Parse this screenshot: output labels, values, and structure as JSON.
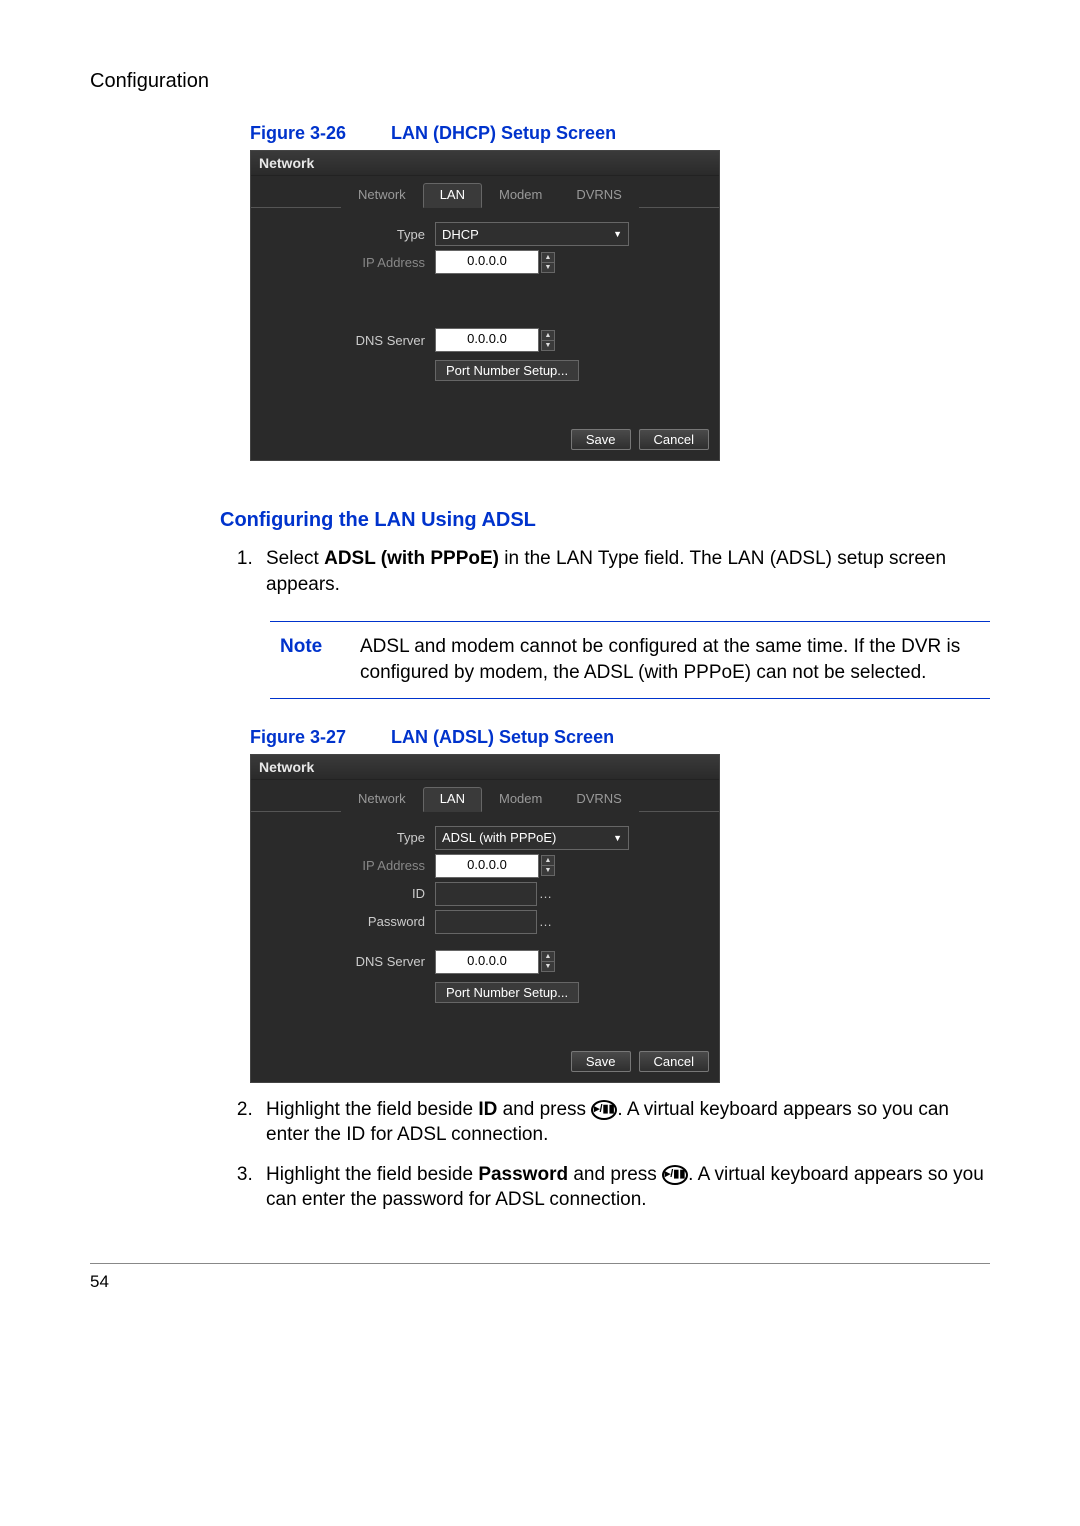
{
  "header": {
    "section": "Configuration"
  },
  "figure26": {
    "label": "Figure 3-26",
    "title": "LAN (DHCP) Setup Screen",
    "window_title": "Network",
    "tabs": [
      "Network",
      "LAN",
      "Modem",
      "DVRNS"
    ],
    "active_tab": "LAN",
    "type_label": "Type",
    "type_value": "DHCP",
    "ip_label": "IP Address",
    "ip_value": "0.0.0.0",
    "dns_label": "DNS Server",
    "dns_value": "0.0.0.0",
    "port_btn": "Port Number Setup...",
    "save": "Save",
    "cancel": "Cancel"
  },
  "subheading": "Configuring the LAN Using ADSL",
  "step1": {
    "pre": "Select ",
    "bold": "ADSL (with PPPoE)",
    "post": " in the LAN Type field. The LAN (ADSL) setup screen appears."
  },
  "note": {
    "label": "Note",
    "text": "ADSL and modem cannot be configured at the same time. If the DVR is configured by modem, the ADSL (with PPPoE) can not be selected."
  },
  "figure27": {
    "label": "Figure 3-27",
    "title": "LAN (ADSL) Setup Screen",
    "window_title": "Network",
    "tabs": [
      "Network",
      "LAN",
      "Modem",
      "DVRNS"
    ],
    "active_tab": "LAN",
    "type_label": "Type",
    "type_value": "ADSL (with PPPoE)",
    "ip_label": "IP Address",
    "ip_value": "0.0.0.0",
    "id_label": "ID",
    "password_label": "Password",
    "dns_label": "DNS Server",
    "dns_value": "0.0.0.0",
    "port_btn": "Port Number Setup...",
    "save": "Save",
    "cancel": "Cancel"
  },
  "step2": {
    "pre": "Highlight the field beside ",
    "bold": "ID",
    "mid": " and press ",
    "post": ". A virtual keyboard appears so you can enter the ID for ADSL connection."
  },
  "step3": {
    "pre": "Highlight the field beside ",
    "bold": "Password",
    "mid": " and press ",
    "post": ". A virtual keyboard appears so you can enter the password for ADSL connection."
  },
  "glyph": "▸/▮▮",
  "page_number": "54"
}
